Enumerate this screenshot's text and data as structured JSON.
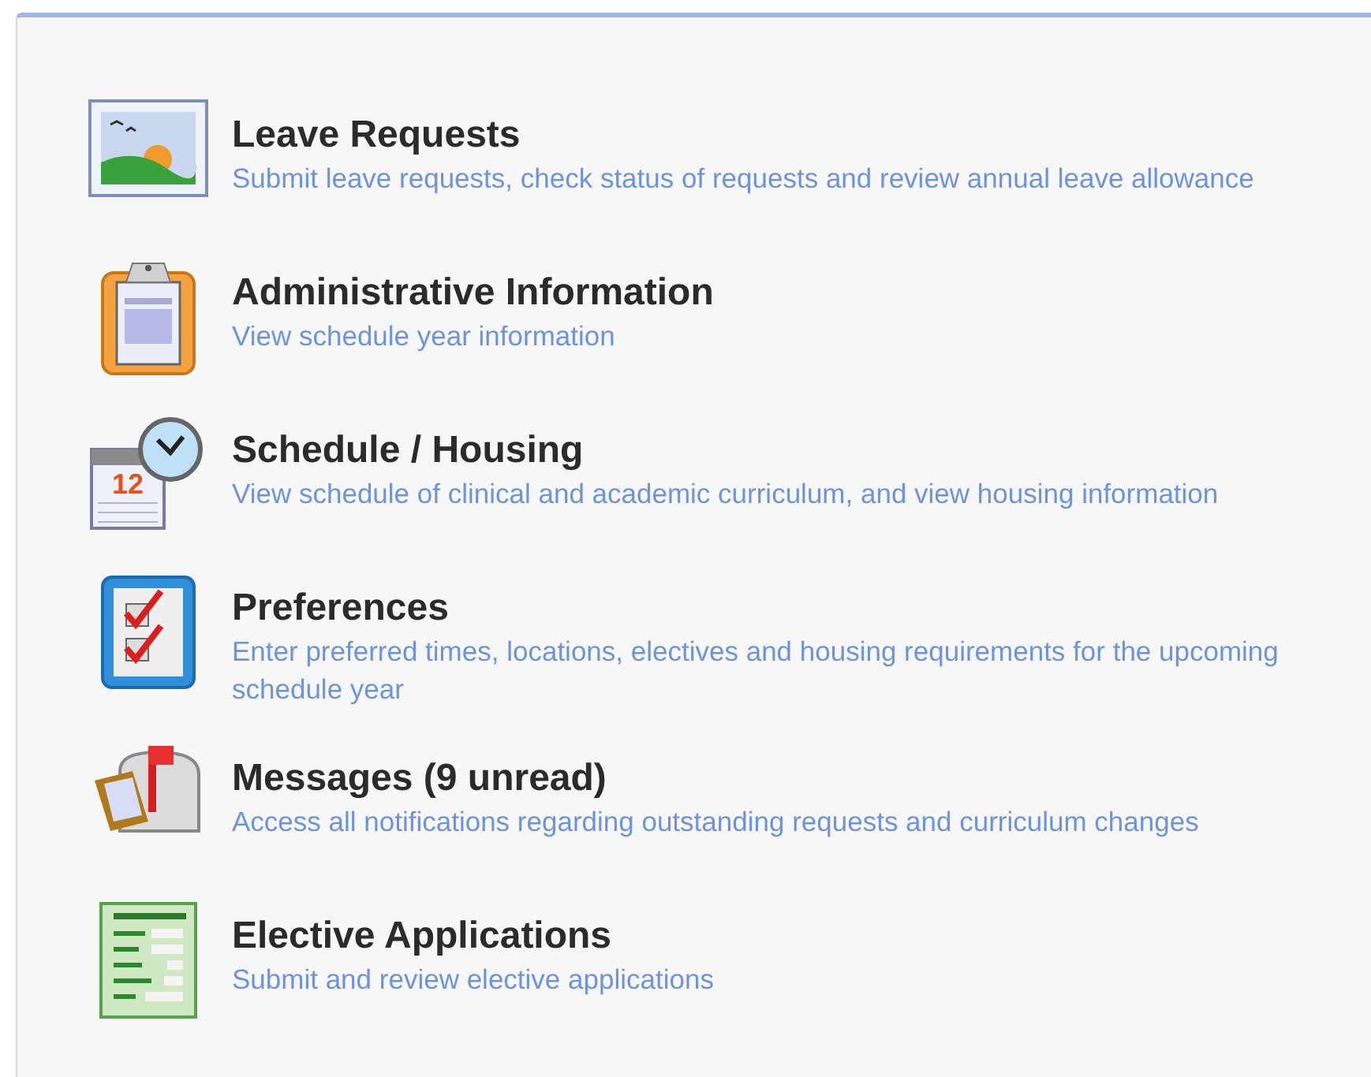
{
  "items": [
    {
      "kind": "landscape",
      "title": "Leave Requests",
      "description": "Submit leave requests, check status of requests and review annual leave allowance"
    },
    {
      "kind": "clipboard",
      "title": "Administrative Information",
      "description": "View schedule year information"
    },
    {
      "kind": "calendar",
      "title": "Schedule / Housing",
      "description": "View schedule of clinical and academic curriculum, and view housing information",
      "icon_text": "12"
    },
    {
      "kind": "checklist",
      "title": "Preferences",
      "description": "Enter preferred times, locations, electives and housing requirements for the upcoming schedule year"
    },
    {
      "kind": "mailbox",
      "title": "Messages (9 unread)",
      "description": "Access all notifications regarding outstanding requests and curriculum changes"
    },
    {
      "kind": "form",
      "title": "Elective Applications",
      "description": "Submit and review elective applications"
    }
  ]
}
